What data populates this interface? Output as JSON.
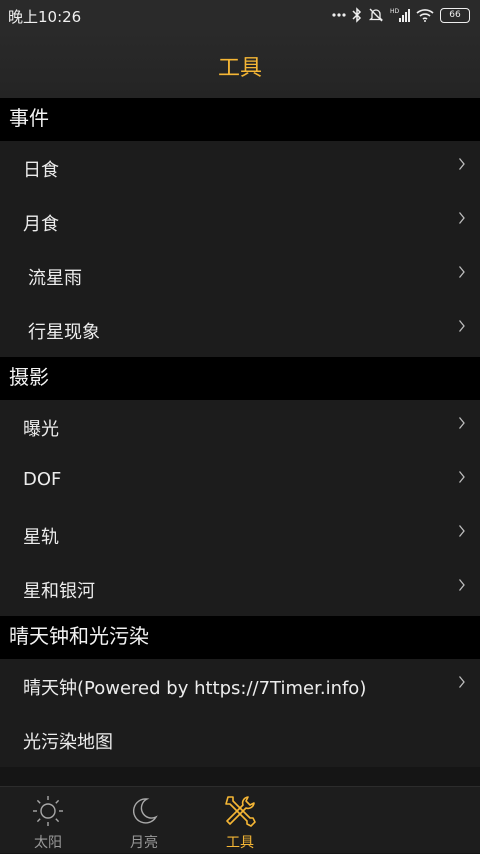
{
  "status_bar": {
    "time": "晚上10:26",
    "battery": "66",
    "icons": [
      "more-dots-icon",
      "bluetooth-icon",
      "silent-mode-icon",
      "hd-signal-icon",
      "wifi-icon",
      "battery-icon"
    ]
  },
  "header": {
    "title": "工具"
  },
  "sections": [
    {
      "title": "事件",
      "items": [
        {
          "label": "日食"
        },
        {
          "label": "月食"
        },
        {
          "label": "流星雨"
        },
        {
          "label": "行星现象"
        }
      ]
    },
    {
      "title": "摄影",
      "items": [
        {
          "label": "曝光"
        },
        {
          "label": "DOF"
        },
        {
          "label": "星轨"
        },
        {
          "label": "星和银河"
        }
      ]
    },
    {
      "title": "晴天钟和光污染",
      "items": [
        {
          "label": "晴天钟(Powered by https://7Timer.info)"
        },
        {
          "label": "光污染地图"
        }
      ]
    }
  ],
  "tabs": [
    {
      "label": "太阳",
      "icon": "sun-icon",
      "active": false
    },
    {
      "label": "月亮",
      "icon": "moon-icon",
      "active": false
    },
    {
      "label": "工具",
      "icon": "tools-icon",
      "active": true
    }
  ],
  "colors": {
    "accent": "#f5b635",
    "background": "#1c1c1c",
    "section_header": "#000000",
    "status_bar": "#2a2a2a"
  }
}
